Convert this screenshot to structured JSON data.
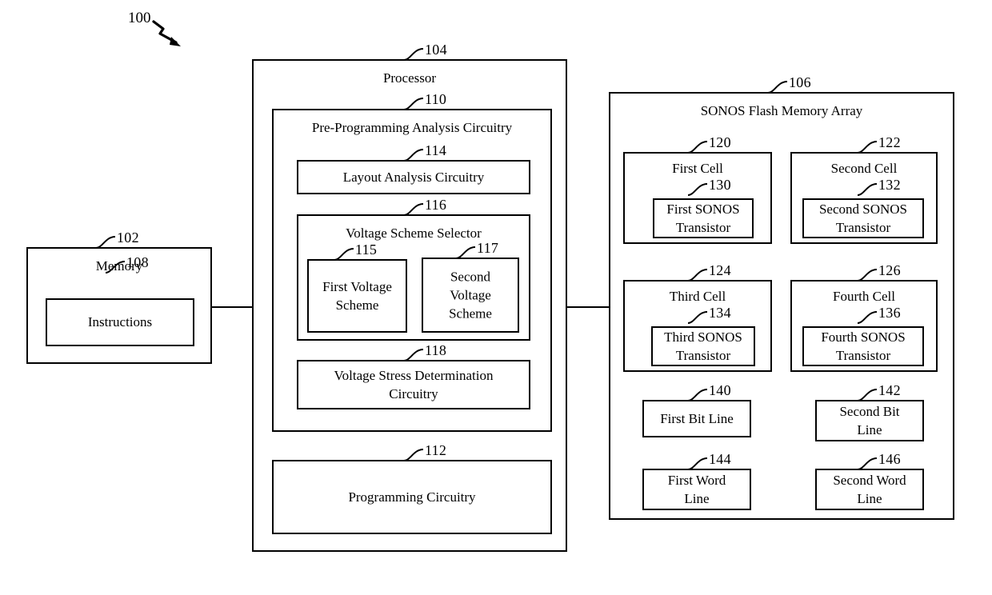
{
  "figure": {
    "number": "100",
    "arrow_icon": "zigzag-arrow-icon"
  },
  "blocks": {
    "memory": {
      "ref": "102",
      "title": "Memory",
      "instructions": {
        "ref": "108",
        "label": "Instructions"
      }
    },
    "processor": {
      "ref": "104",
      "title": "Processor",
      "pre_programming_analysis": {
        "ref": "110",
        "title": "Pre-Programming Analysis Circuitry",
        "layout_analysis": {
          "ref": "114",
          "label": "Layout Analysis Circuitry"
        },
        "voltage_scheme_selector": {
          "ref": "116",
          "title": "Voltage Scheme Selector",
          "first_voltage_scheme": {
            "ref": "115",
            "label": "First Voltage Scheme"
          },
          "second_voltage_scheme": {
            "ref": "117",
            "label": "Second Voltage Scheme"
          }
        },
        "voltage_stress_determination": {
          "ref": "118",
          "label": "Voltage Stress Determination Circuitry"
        }
      },
      "programming_circuitry": {
        "ref": "112",
        "label": "Programming Circuitry"
      }
    },
    "sonos_array": {
      "ref": "106",
      "title": "SONOS Flash Memory Array",
      "cells": [
        {
          "ref": "120",
          "title": "First Cell",
          "transistor": {
            "ref": "130",
            "label": "First SONOS Transistor"
          }
        },
        {
          "ref": "122",
          "title": "Second Cell",
          "transistor": {
            "ref": "132",
            "label": "Second SONOS Transistor"
          }
        },
        {
          "ref": "124",
          "title": "Third Cell",
          "transistor": {
            "ref": "134",
            "label": "Third SONOS Transistor"
          }
        },
        {
          "ref": "126",
          "title": "Fourth Cell",
          "transistor": {
            "ref": "136",
            "label": "Fourth SONOS Transistor"
          }
        }
      ],
      "lines": [
        {
          "ref": "140",
          "label": "First Bit Line"
        },
        {
          "ref": "142",
          "label": "Second Bit Line"
        },
        {
          "ref": "144",
          "label": "First Word Line"
        },
        {
          "ref": "146",
          "label": "Second Word Line"
        }
      ]
    }
  },
  "connections": [
    {
      "name": "memory-to-processor"
    },
    {
      "name": "processor-to-sonos-array"
    }
  ],
  "style": {
    "line_color": "#000000",
    "background": "#ffffff"
  }
}
